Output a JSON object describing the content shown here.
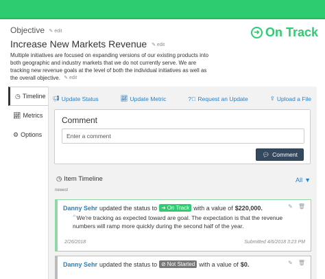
{
  "objective": {
    "label": "Objective",
    "edit_label": "edit",
    "title": "Increase New Markets Revenue",
    "status_label": "On Track",
    "description": "Multiple initiatives are focused on expanding versions of our existing products into both geographic and industry markets that we do not currently serve. We are tracking new revenue goals at the level of both the individual initiatives as well as the overall objective.",
    "colors": {
      "topbar": "#2ecc71",
      "on_track": "#2ecc71",
      "link": "#2a7fc1"
    }
  },
  "sidebar": {
    "items": [
      {
        "label": "Timeline",
        "icon": "clock-icon",
        "active": true
      },
      {
        "label": "Metrics",
        "icon": "line-chart-icon",
        "active": false
      },
      {
        "label": "Options",
        "icon": "gear-icon",
        "active": false
      }
    ]
  },
  "actions": {
    "update_status": "Update Status",
    "update_metric": "Update Metric",
    "request_update": "Request an Update",
    "upload_file": "Upload a File"
  },
  "comment": {
    "title": "Comment",
    "placeholder": "Enter a comment",
    "button_label": "Comment"
  },
  "timeline": {
    "title": "Item Timeline",
    "filter_label": "All",
    "sort_label": "newest",
    "entries": [
      {
        "user": "Danny Sehr",
        "text_pre": "updated the status to",
        "status": "On Track",
        "text_mid": "with a value of",
        "value": "$220,000.",
        "quote": "We're tracking as expected toward are goal. The expectation is that the revenue numbers will ramp more quickly during the second half of the year.",
        "date": "2/26/2018",
        "submitted": "Submitted 4/6/2018 3:23 PM"
      },
      {
        "user": "Danny Sehr",
        "text_pre": "updated the status to",
        "status": "Not Started",
        "text_mid": "with a value of",
        "value": "$0."
      }
    ]
  }
}
